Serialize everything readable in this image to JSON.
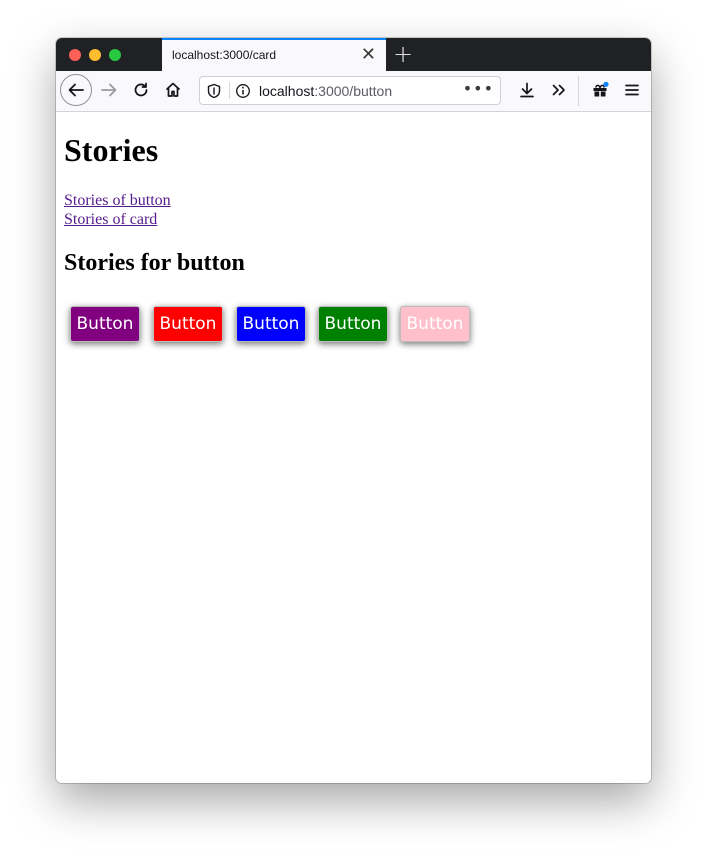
{
  "browser": {
    "tab": {
      "title": "localhost:3000/card",
      "close_glyph": "✕"
    },
    "new_tab_glyph": "+",
    "url": {
      "host": "localhost",
      "path": ":3000/button",
      "more_glyph": "•••"
    },
    "icons": [
      "back-arrow-icon",
      "forward-arrow-icon",
      "reload-icon",
      "home-icon",
      "shield-icon",
      "info-icon",
      "download-icon",
      "overflow-chevron-icon",
      "extensions-icon",
      "hamburger-menu-icon"
    ]
  },
  "page": {
    "title": "Stories",
    "links": [
      {
        "label": "Stories of button"
      },
      {
        "label": "Stories of card"
      }
    ],
    "section_title": "Stories for button",
    "buttons": [
      {
        "label": "Button",
        "color": "#800080"
      },
      {
        "label": "Button",
        "color": "#ff0000"
      },
      {
        "label": "Button",
        "color": "#0000ff"
      },
      {
        "label": "Button",
        "color": "#008000"
      },
      {
        "label": "Button",
        "color": "#ffc0cb"
      }
    ]
  }
}
